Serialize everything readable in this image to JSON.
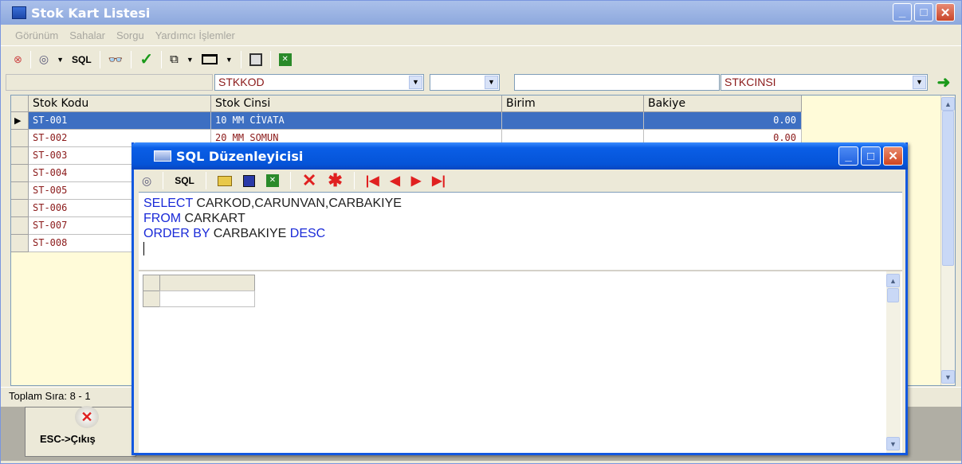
{
  "main_window": {
    "title": "Stok Kart Listesi",
    "menu": [
      "Görünüm",
      "Sahalar",
      "Sorgu",
      "Yardımcı İşlemler"
    ],
    "toolbar": {
      "sql_label": "SQL"
    },
    "filter": {
      "field1": "STKKOD",
      "field2": "",
      "value": "",
      "field3": "STKCINSI"
    },
    "grid": {
      "columns": [
        "Stok Kodu",
        "Stok Cinsi",
        "Birim",
        "Bakiye"
      ],
      "rows": [
        {
          "kod": "ST-001",
          "cins": "10 MM CİVATA",
          "birim": "",
          "bakiye": "0.00"
        },
        {
          "kod": "ST-002",
          "cins": "20 MM SOMUN",
          "birim": "",
          "bakiye": "0.00"
        },
        {
          "kod": "ST-003",
          "cins": "",
          "birim": "",
          "bakiye": ""
        },
        {
          "kod": "ST-004",
          "cins": "",
          "birim": "",
          "bakiye": ""
        },
        {
          "kod": "ST-005",
          "cins": "",
          "birim": "",
          "bakiye": ""
        },
        {
          "kod": "ST-006",
          "cins": "",
          "birim": "",
          "bakiye": ""
        },
        {
          "kod": "ST-007",
          "cins": "",
          "birim": "",
          "bakiye": ""
        },
        {
          "kod": "ST-008",
          "cins": "",
          "birim": "",
          "bakiye": ""
        }
      ]
    },
    "status": "Toplam Sıra: 8 - 1",
    "esc_button": "ESC->Çıkış"
  },
  "dialog": {
    "title": "SQL Düzenleyicisi",
    "toolbar": {
      "sql_label": "SQL"
    },
    "sql": {
      "line1_kw": "SELECT",
      "line1_rest": " CARKOD,CARUNVAN,CARBAKIYE",
      "line2_kw": "FROM",
      "line2_rest": " CARKART",
      "line3_kw": "ORDER BY",
      "line3_mid": " CARBAKIYE ",
      "line3_kw2": "DESC"
    }
  }
}
